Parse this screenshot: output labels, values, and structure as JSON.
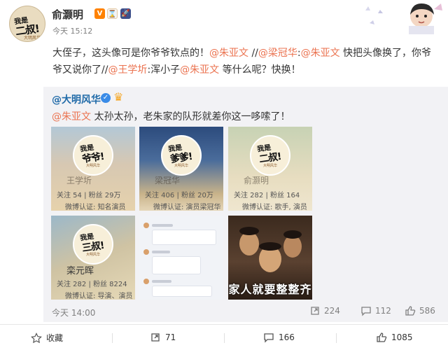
{
  "header": {
    "username": "俞灏明",
    "badge_v": "V",
    "badge_h": "⌛",
    "badge_r": "🚀",
    "time": "今天 15:12",
    "avatar": {
      "line1": "我是",
      "line2": "二叔!",
      "line3": "大明风华"
    }
  },
  "post": {
    "text_a": "大侄子，这头像可是你爷爷钦点的！",
    "mention1": "@朱亚文",
    "sep1": " //",
    "mention2": "@梁冠华",
    "colon1": ":",
    "mention3": "@朱亚文",
    "text_b": " 快把头像换了，你爷爷又说你了",
    "sep2": "//",
    "mention4": "@王学圻",
    "text_c": ":浑小子",
    "mention5": "@朱亚文",
    "text_d": " 等什么呢？快换！"
  },
  "repost": {
    "author": "@大明风华",
    "vbadge": "✓",
    "gold_icon": "♛",
    "mention": "@朱亚文",
    "text": " 太孙太孙，老朱家的队形就差你这一哆嗦了！",
    "images": [
      {
        "badge1": "我是",
        "badge2": "爷爷!",
        "badge3": "大明风华",
        "name": "王学圻",
        "stats": "关注 54 | 粉丝 29万",
        "cert": "微博认证: 知名演员"
      },
      {
        "badge1": "我是",
        "badge2": "爹爹!",
        "badge3": "大明风华",
        "name": "梁冠华",
        "stats": "关注 406 | 粉丝 20万",
        "cert": "微博认证: 演员梁冠华"
      },
      {
        "badge1": "我是",
        "badge2": "二叔!",
        "badge3": "大明风华",
        "name": "俞灏明",
        "stats": "关注 282 | 粉丝 164",
        "cert": "微博认证: 歌手, 演员"
      },
      {
        "badge1": "我是",
        "badge2": "三叔!",
        "badge3": "大明风华",
        "name": "栾元晖",
        "stats": "关注 282 | 粉丝 8224",
        "cert": "微博认证: 导演、演员"
      },
      {
        "caption": ""
      },
      {
        "caption": "家人就要整整齐"
      }
    ],
    "time": "今天 14:00",
    "repost_count": "224",
    "comment_count": "112",
    "like_count": "586"
  },
  "toolbar": {
    "favorite": "收藏",
    "repost": "71",
    "comment": "166",
    "like": "1085"
  },
  "colors": {
    "link": "#eb7350",
    "repost_bg": "#f2f2f5",
    "author_blue": "#1f6aa8"
  },
  "icons": [
    "star-icon",
    "repost-icon",
    "comment-icon",
    "thumbs-up-icon",
    "verified-icon",
    "gold-crown-icon"
  ]
}
